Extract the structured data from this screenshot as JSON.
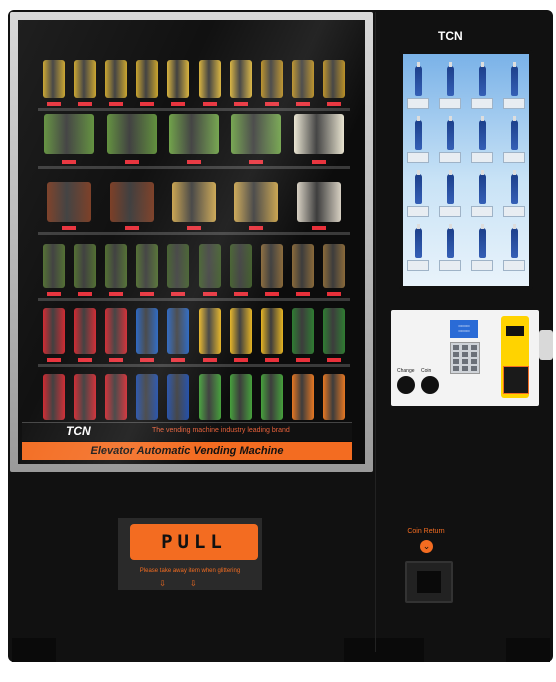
{
  "brand": "TCN",
  "banner": {
    "logo": "TCN",
    "tagline": "The vending machine industry leading brand",
    "bar_text": "Elevator Automatic Vending Machine"
  },
  "controls": {
    "change_label": "Change",
    "coin_label": "Coin"
  },
  "pickup": {
    "pull_label": "PULL",
    "instruction": "Please take away item when glittering",
    "arrows": "⇩⇩"
  },
  "coin_return": {
    "label": "Coin Return",
    "icon": "chevron-down-icon"
  },
  "colors": {
    "accent": "#f36c21",
    "cabinet": "#111111",
    "price_tag": "#e8303a"
  }
}
